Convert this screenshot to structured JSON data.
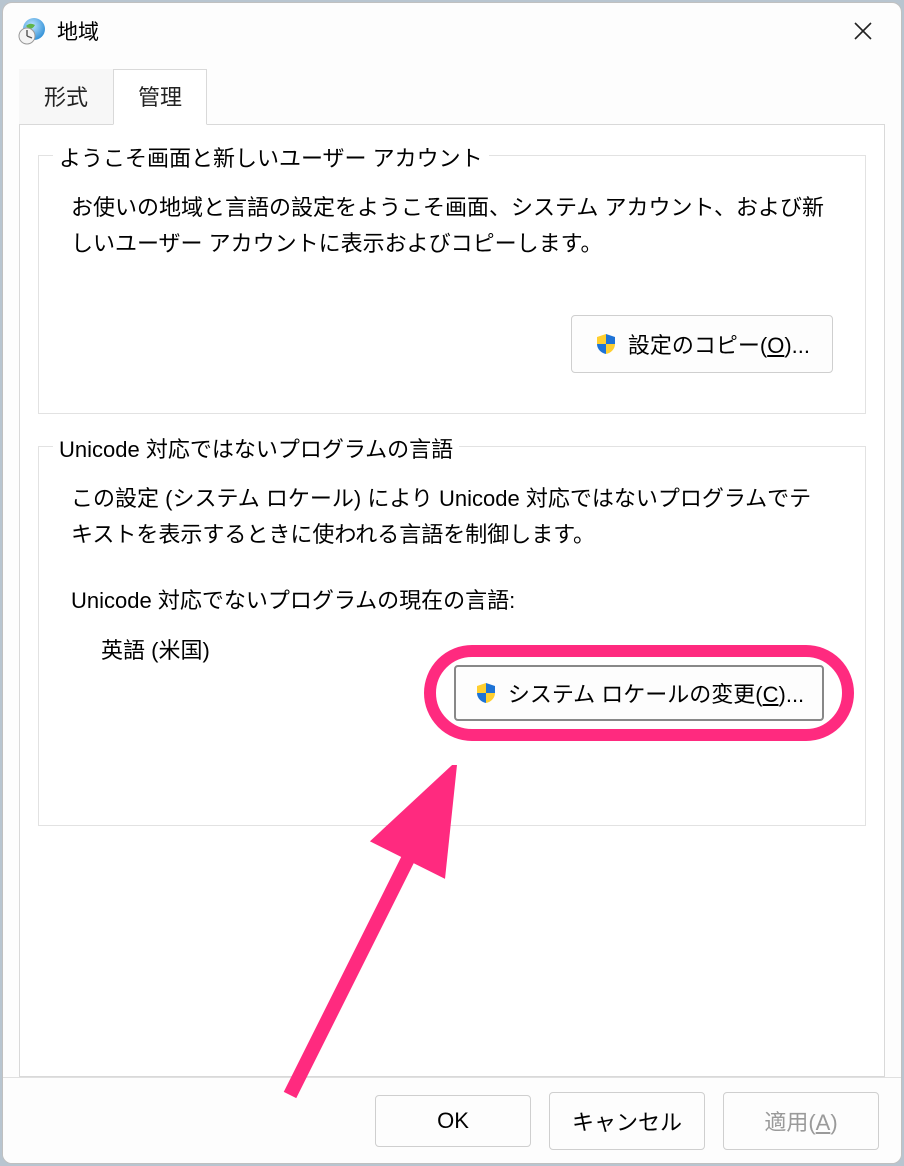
{
  "window": {
    "title": "地域"
  },
  "tabs": {
    "format": "形式",
    "admin": "管理"
  },
  "group1": {
    "legend": "ようこそ画面と新しいユーザー アカウント",
    "desc": "お使いの地域と言語の設定をようこそ画面、システム アカウント、および新しいユーザー アカウントに表示およびコピーします。",
    "copy_btn_prefix": "設定のコピー(",
    "copy_btn_mnemonic": "O",
    "copy_btn_suffix": ")..."
  },
  "group2": {
    "legend": "Unicode 対応ではないプログラムの言語",
    "desc": "この設定 (システム ロケール) により Unicode 対応ではないプログラムでテキストを表示するときに使われる言語を制御します。",
    "current_label": "Unicode 対応でないプログラムの現在の言語:",
    "current_value": "英語 (米国)",
    "change_btn_prefix": "システム ロケールの変更(",
    "change_btn_mnemonic": "C",
    "change_btn_suffix": ")..."
  },
  "buttons": {
    "ok": "OK",
    "cancel": "キャンセル",
    "apply_prefix": "適用(",
    "apply_mnemonic": "A",
    "apply_suffix": ")"
  }
}
